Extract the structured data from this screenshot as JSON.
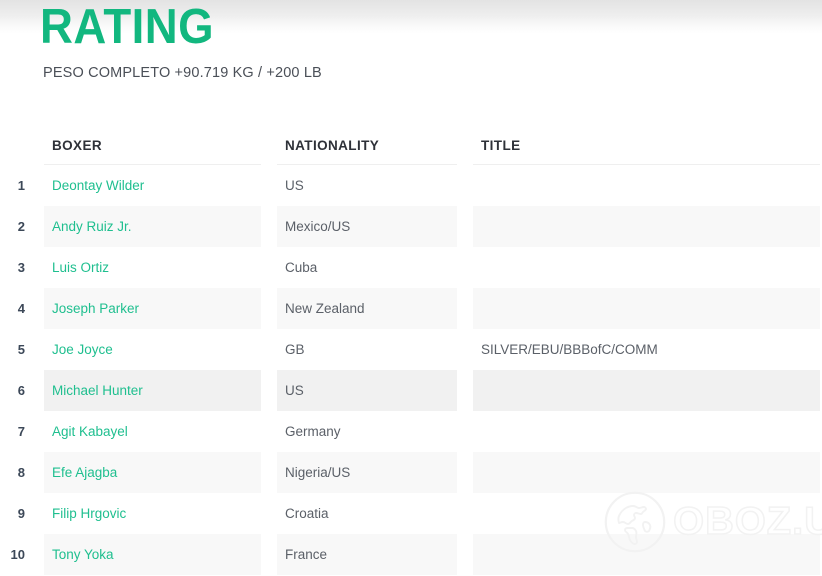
{
  "header": {
    "title": "RATING",
    "subtitle": "PESO COMPLETO +90.719 KG / +200 LB",
    "title_color": "#12b77f"
  },
  "table": {
    "columns": {
      "rank": "",
      "boxer": "BOXER",
      "nationality": "NATIONALITY",
      "title": "TITLE"
    },
    "rows": [
      {
        "rank": "1",
        "boxer": "Deontay Wilder",
        "nationality": "US",
        "title": ""
      },
      {
        "rank": "2",
        "boxer": "Andy Ruiz Jr.",
        "nationality": "Mexico/US",
        "title": ""
      },
      {
        "rank": "3",
        "boxer": "Luis Ortiz",
        "nationality": "Cuba",
        "title": ""
      },
      {
        "rank": "4",
        "boxer": "Joseph Parker",
        "nationality": "New Zealand",
        "title": ""
      },
      {
        "rank": "5",
        "boxer": "Joe Joyce",
        "nationality": "GB",
        "title": "SILVER/EBU/BBBofC/COMM"
      },
      {
        "rank": "6",
        "boxer": "Michael Hunter",
        "nationality": "US",
        "title": ""
      },
      {
        "rank": "7",
        "boxer": "Agit Kabayel",
        "nationality": "Germany",
        "title": ""
      },
      {
        "rank": "8",
        "boxer": "Efe Ajagba",
        "nationality": "Nigeria/US",
        "title": ""
      },
      {
        "rank": "9",
        "boxer": "Filip Hrgovic",
        "nationality": "Croatia",
        "title": ""
      },
      {
        "rank": "10",
        "boxer": "Tony Yoka",
        "nationality": "France",
        "title": ""
      }
    ],
    "link_color": "#1fbf8f",
    "stripe_color": "#f8f8f8",
    "hover_color": "#f1f1f1"
  },
  "watermark": {
    "text": "OBOZ.UA",
    "icon": "globe-icon",
    "color": "#f2f2f2"
  }
}
